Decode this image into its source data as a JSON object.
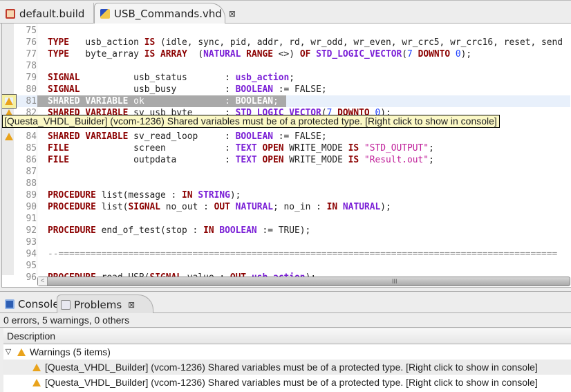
{
  "tabs": [
    {
      "label": "default.build",
      "icon": "build-file-icon"
    },
    {
      "label": "USB_Commands.vhd",
      "icon": "vhdl-file-warning-icon",
      "close": "⊠"
    }
  ],
  "editor": {
    "lines": [
      {
        "n": "75",
        "t": []
      },
      {
        "n": "76",
        "t": [
          [
            "kw",
            "TYPE"
          ],
          [
            "",
            "   usb_action "
          ],
          [
            "kw",
            "IS"
          ],
          [
            "",
            ". (idle, sync, pid, addr, rd, wr_odd, wr_even, wr_crc5, wr_crc16, reset, send"
          ]
        ]
      },
      {
        "n": "77",
        "t": [
          [
            "kw",
            "TYPE"
          ],
          [
            "",
            "   byte_array "
          ],
          [
            "kw",
            "IS ARRAY"
          ],
          [
            "",
            "  ("
          ],
          [
            "ty",
            "NATURAL"
          ],
          [
            "kw",
            " RANGE"
          ],
          [
            "",
            " <>) "
          ],
          [
            "kw",
            "OF"
          ],
          [
            "ty",
            " STD_LOGIC_VECTOR"
          ],
          [
            "",
            "("
          ],
          [
            "nm",
            "7"
          ],
          [
            "kw",
            " DOWNTO"
          ],
          [
            "nm",
            " 0"
          ],
          [
            "",
            ");"
          ]
        ]
      },
      {
        "n": "78",
        "t": []
      },
      {
        "n": "79",
        "t": [
          [
            "kw",
            "SIGNAL"
          ],
          [
            "",
            "          usb_status       : "
          ],
          [
            "ty",
            "usb_action"
          ],
          [
            "",
            ";"
          ]
        ]
      },
      {
        "n": "80",
        "t": [
          [
            "kw",
            "SIGNAL"
          ],
          [
            "",
            "          usb_busy         : "
          ],
          [
            "ty",
            "BOOLEAN"
          ],
          [
            "",
            " := FALSE;"
          ]
        ]
      },
      {
        "n": "81",
        "t": [
          [
            "kw",
            "SHARED VARIABLE"
          ],
          [
            "",
            " ok               : "
          ],
          [
            "ty",
            "BOOLEAN"
          ],
          [
            "",
            ";"
          ]
        ],
        "warn": true,
        "selected": true
      },
      {
        "n": "82",
        "t": [
          [
            "kw",
            "SHARED VARIABLE"
          ],
          [
            "",
            " sv_usb_byte      : "
          ],
          [
            "ty",
            "STD_LOGIC_VECTOR"
          ],
          [
            "",
            "("
          ],
          [
            "nm",
            "7"
          ],
          [
            "kw",
            " DOWNTO"
          ],
          [
            "nm",
            " 0"
          ],
          [
            "",
            ");"
          ]
        ],
        "warn": true
      },
      {
        "n": "83",
        "t": []
      },
      {
        "n": "84",
        "t": [
          [
            "kw",
            "SHARED VARIABLE"
          ],
          [
            "",
            " sv_read_loop     : "
          ],
          [
            "ty",
            "BOOLEAN"
          ],
          [
            "",
            " := FALSE;"
          ]
        ],
        "warn": true
      },
      {
        "n": "85",
        "t": [
          [
            "kw",
            "FILE"
          ],
          [
            "",
            "            screen           : "
          ],
          [
            "ty",
            "TEXT"
          ],
          [
            "kw",
            " OPEN"
          ],
          [
            "",
            " WRITE_MODE "
          ],
          [
            "kw",
            "IS"
          ],
          [
            "st",
            " \"STD_OUTPUT\""
          ],
          [
            "",
            ";"
          ]
        ]
      },
      {
        "n": "86",
        "t": [
          [
            "kw",
            "FILE"
          ],
          [
            "",
            "            outpdata         : "
          ],
          [
            "ty",
            "TEXT"
          ],
          [
            "kw",
            " OPEN"
          ],
          [
            "",
            " WRITE_MODE "
          ],
          [
            "kw",
            "IS"
          ],
          [
            "st",
            " \"Result.out\""
          ],
          [
            "",
            ";"
          ]
        ]
      },
      {
        "n": "87",
        "t": []
      },
      {
        "n": "88",
        "t": []
      },
      {
        "n": "89",
        "t": [
          [
            "kw",
            "PROCEDURE"
          ],
          [
            "",
            " list(message : "
          ],
          [
            "kw",
            "IN"
          ],
          [
            "ty",
            " STRING"
          ],
          [
            "",
            ");"
          ]
        ]
      },
      {
        "n": "90",
        "t": [
          [
            "kw",
            "PROCEDURE"
          ],
          [
            "",
            " list("
          ],
          [
            "kw",
            "SIGNAL"
          ],
          [
            "",
            " no_out : "
          ],
          [
            "kw",
            "OUT"
          ],
          [
            "ty",
            " NATURAL"
          ],
          [
            "",
            "; no_in : "
          ],
          [
            "kw",
            "IN"
          ],
          [
            "ty",
            " NATURAL"
          ],
          [
            "",
            ");"
          ]
        ]
      },
      {
        "n": "91",
        "t": []
      },
      {
        "n": "92",
        "t": [
          [
            "kw",
            "PROCEDURE"
          ],
          [
            "",
            " end_of_test(stop : "
          ],
          [
            "kw",
            "IN"
          ],
          [
            "ty",
            " BOOLEAN"
          ],
          [
            "",
            " := TRUE);"
          ]
        ]
      },
      {
        "n": "93",
        "t": []
      },
      {
        "n": "94",
        "t": [
          [
            "cm",
            "--============================================================================================="
          ]
        ],
        "comment": true
      },
      {
        "n": "95",
        "t": []
      },
      {
        "n": "96",
        "t": [
          [
            "kw",
            "PROCEDURE"
          ],
          [
            "",
            " read_USB("
          ],
          [
            "kw",
            "SIGNAL"
          ],
          [
            "",
            " value : "
          ],
          [
            "kw",
            "OUT"
          ],
          [
            "ty",
            " usb_action"
          ],
          [
            "",
            ");"
          ]
        ]
      }
    ],
    "tooltip": "[Questa_VHDL_Builder] (vcom-1236) Shared variables must be of a protected type. [Right click to show in console]",
    "scroll_grip": "III"
  },
  "panel": {
    "tabs": [
      {
        "label": "Console",
        "icon": "console-icon"
      },
      {
        "label": "Problems",
        "icon": "problems-icon",
        "close": "⊠"
      }
    ],
    "status": "0 errors, 5 warnings, 0 others",
    "column": "Description",
    "group": "Warnings (5 items)",
    "items": [
      "[Questa_VHDL_Builder] (vcom-1236) Shared variables must be of a protected type. [Right click to show in console]",
      "[Questa_VHDL_Builder] (vcom-1236) Shared variables must be of a protected type. [Right click to show in console]"
    ]
  },
  "colors": {
    "keyword": "#8b0000",
    "type": "#7a1fd6",
    "number": "#1d3fff",
    "string": "#c0209a",
    "warning": "#e9a31c"
  }
}
